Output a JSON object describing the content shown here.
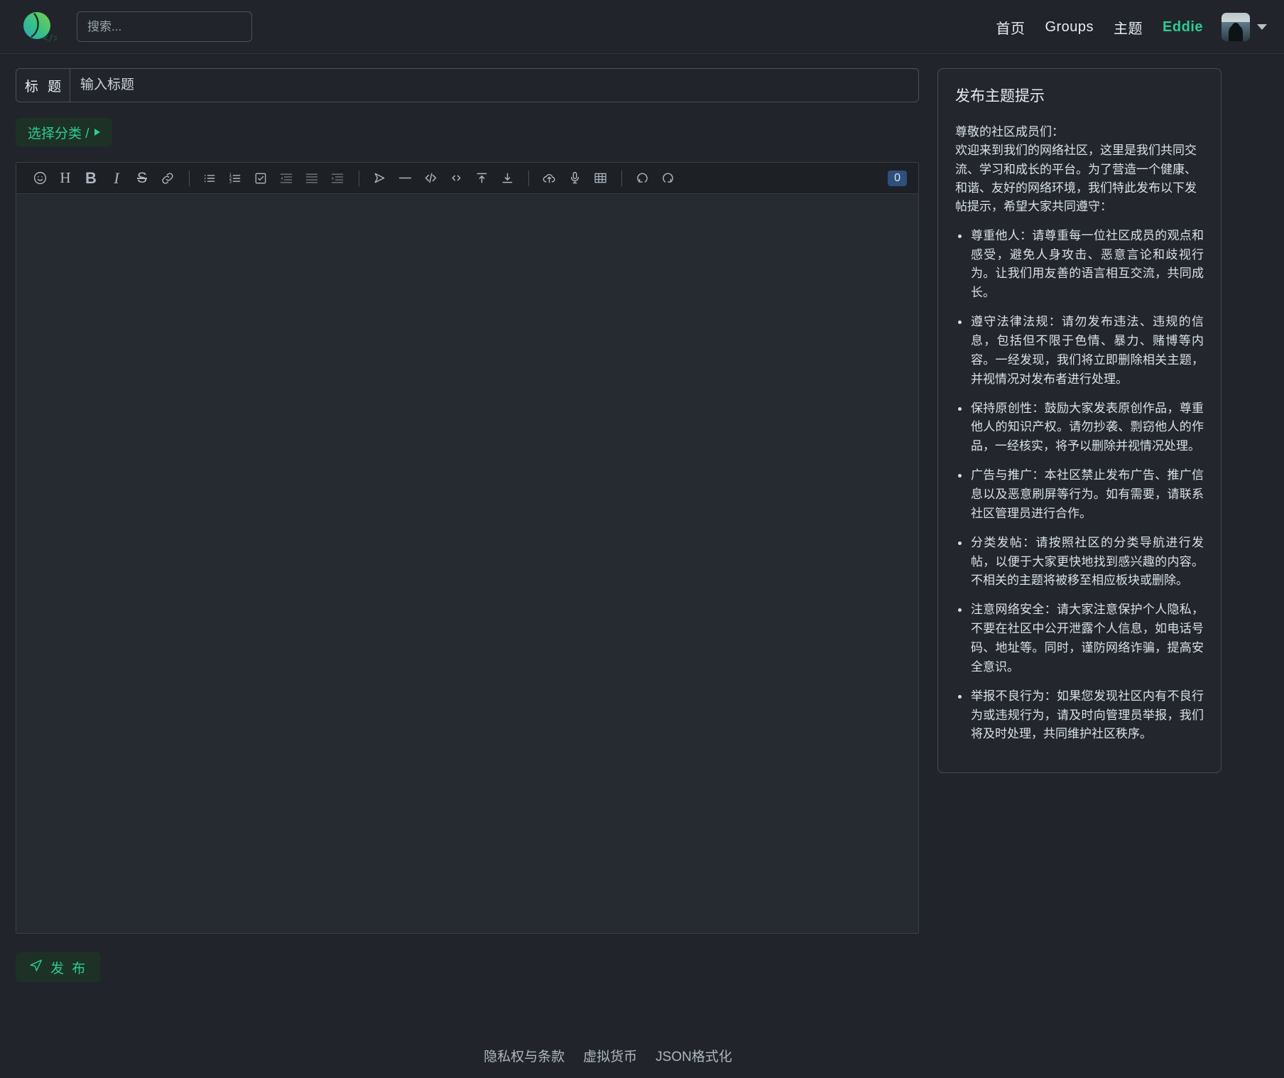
{
  "header": {
    "logo_name": "site-logo",
    "search_placeholder": "搜索...",
    "nav": [
      {
        "label": "首页",
        "name": "nav-home"
      },
      {
        "label": "Groups",
        "name": "nav-groups"
      },
      {
        "label": "主题",
        "name": "nav-topics"
      }
    ],
    "user": "Eddie"
  },
  "compose": {
    "title_label": "标 题",
    "title_value": "",
    "title_placeholder": "输入标题",
    "category_label": "选择分类 /",
    "editor_value": "",
    "char_count": "0",
    "publish_label": "发 布",
    "toolbar": [
      {
        "name": "emoji-icon",
        "title": "表情"
      },
      {
        "name": "heading-icon",
        "title": "标题"
      },
      {
        "name": "bold-icon",
        "title": "加粗"
      },
      {
        "name": "italic-icon",
        "title": "斜体"
      },
      {
        "name": "strikethrough-icon",
        "title": "删除线"
      },
      {
        "name": "link-icon",
        "title": "链接"
      },
      {
        "name": "bullet-list-icon",
        "title": "无序列表"
      },
      {
        "name": "numbered-list-icon",
        "title": "有序列表"
      },
      {
        "name": "checklist-icon",
        "title": "任务列表"
      },
      {
        "name": "outdent-icon",
        "title": "减少缩进"
      },
      {
        "name": "indent-icon",
        "title": "增加缩进"
      },
      {
        "name": "quote-icon",
        "title": "引用"
      },
      {
        "name": "horizontal-rule-icon",
        "title": "分割线"
      },
      {
        "name": "code-block-icon",
        "title": "代码块"
      },
      {
        "name": "inline-code-icon",
        "title": "行内代码"
      },
      {
        "name": "align-top-icon",
        "title": "上标"
      },
      {
        "name": "align-bottom-icon",
        "title": "下标"
      },
      {
        "name": "upload-icon",
        "title": "上传"
      },
      {
        "name": "microphone-icon",
        "title": "语音"
      },
      {
        "name": "table-icon",
        "title": "表格"
      },
      {
        "name": "undo-icon",
        "title": "撤销"
      },
      {
        "name": "redo-icon",
        "title": "重做"
      }
    ]
  },
  "tips": {
    "title": "发布主题提示",
    "intro": "尊敬的社区成员们：\n欢迎来到我们的网络社区，这里是我们共同交流、学习和成长的平台。为了营造一个健康、和谐、友好的网络环境，我们特此发布以下发帖提示，希望大家共同遵守：",
    "items": [
      "尊重他人：请尊重每一位社区成员的观点和感受，避免人身攻击、恶意言论和歧视行为。让我们用友善的语言相互交流，共同成长。",
      "遵守法律法规：请勿发布违法、违规的信息，包括但不限于色情、暴力、赌博等内容。一经发现，我们将立即删除相关主题，并视情况对发布者进行处理。",
      "保持原创性：鼓励大家发表原创作品，尊重他人的知识产权。请勿抄袭、剽窃他人的作品，一经核实，将予以删除并视情况处理。",
      "广告与推广：本社区禁止发布广告、推广信息以及恶意刷屏等行为。如有需要，请联系社区管理员进行合作。",
      "分类发帖：请按照社区的分类导航进行发帖，以便于大家更快地找到感兴趣的内容。不相关的主题将被移至相应板块或删除。",
      "注意网络安全：请大家注意保护个人隐私，不要在社区中公开泄露个人信息，如电话号码、地址等。同时，谨防网络诈骗，提高安全意识。",
      "举报不良行为：如果您发现社区内有不良行为或违规行为，请及时向管理员举报，我们将及时处理，共同维护社区秩序。"
    ]
  },
  "footer": {
    "links": [
      {
        "label": "隐私权与条款",
        "name": "footer-link-privacy"
      },
      {
        "label": "虚拟货币",
        "name": "footer-link-currency"
      },
      {
        "label": "JSON格式化",
        "name": "footer-link-json"
      }
    ]
  },
  "colors": {
    "page_bg": "#21252b",
    "accent_green": "#2ecc8f",
    "accent_green_bg": "#1d3127",
    "counter_badge": "#2f4f7d",
    "border": "#4a5159"
  }
}
